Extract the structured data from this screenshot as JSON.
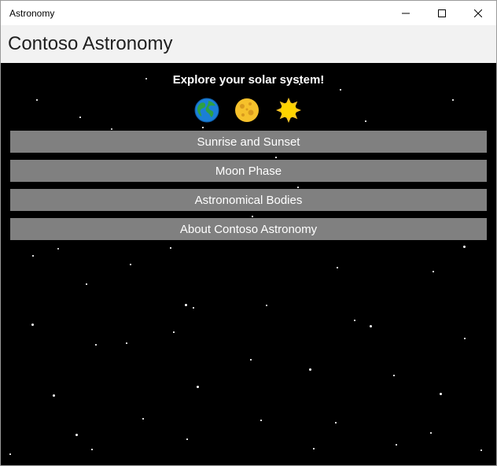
{
  "window": {
    "title": "Astronomy"
  },
  "header": {
    "title": "Contoso Astronomy"
  },
  "main": {
    "headline": "Explore your solar system!",
    "icons": [
      "earth-icon",
      "moon-icon",
      "sun-icon"
    ],
    "buttons": [
      {
        "label": "Sunrise and Sunset"
      },
      {
        "label": "Moon Phase"
      },
      {
        "label": "Astronomical Bodies"
      },
      {
        "label": "About Contoso Astronomy"
      }
    ]
  },
  "colors": {
    "background": "#000000",
    "header_bg": "#f2f2f2",
    "button_bg": "#808080",
    "text_light": "#ffffff"
  }
}
